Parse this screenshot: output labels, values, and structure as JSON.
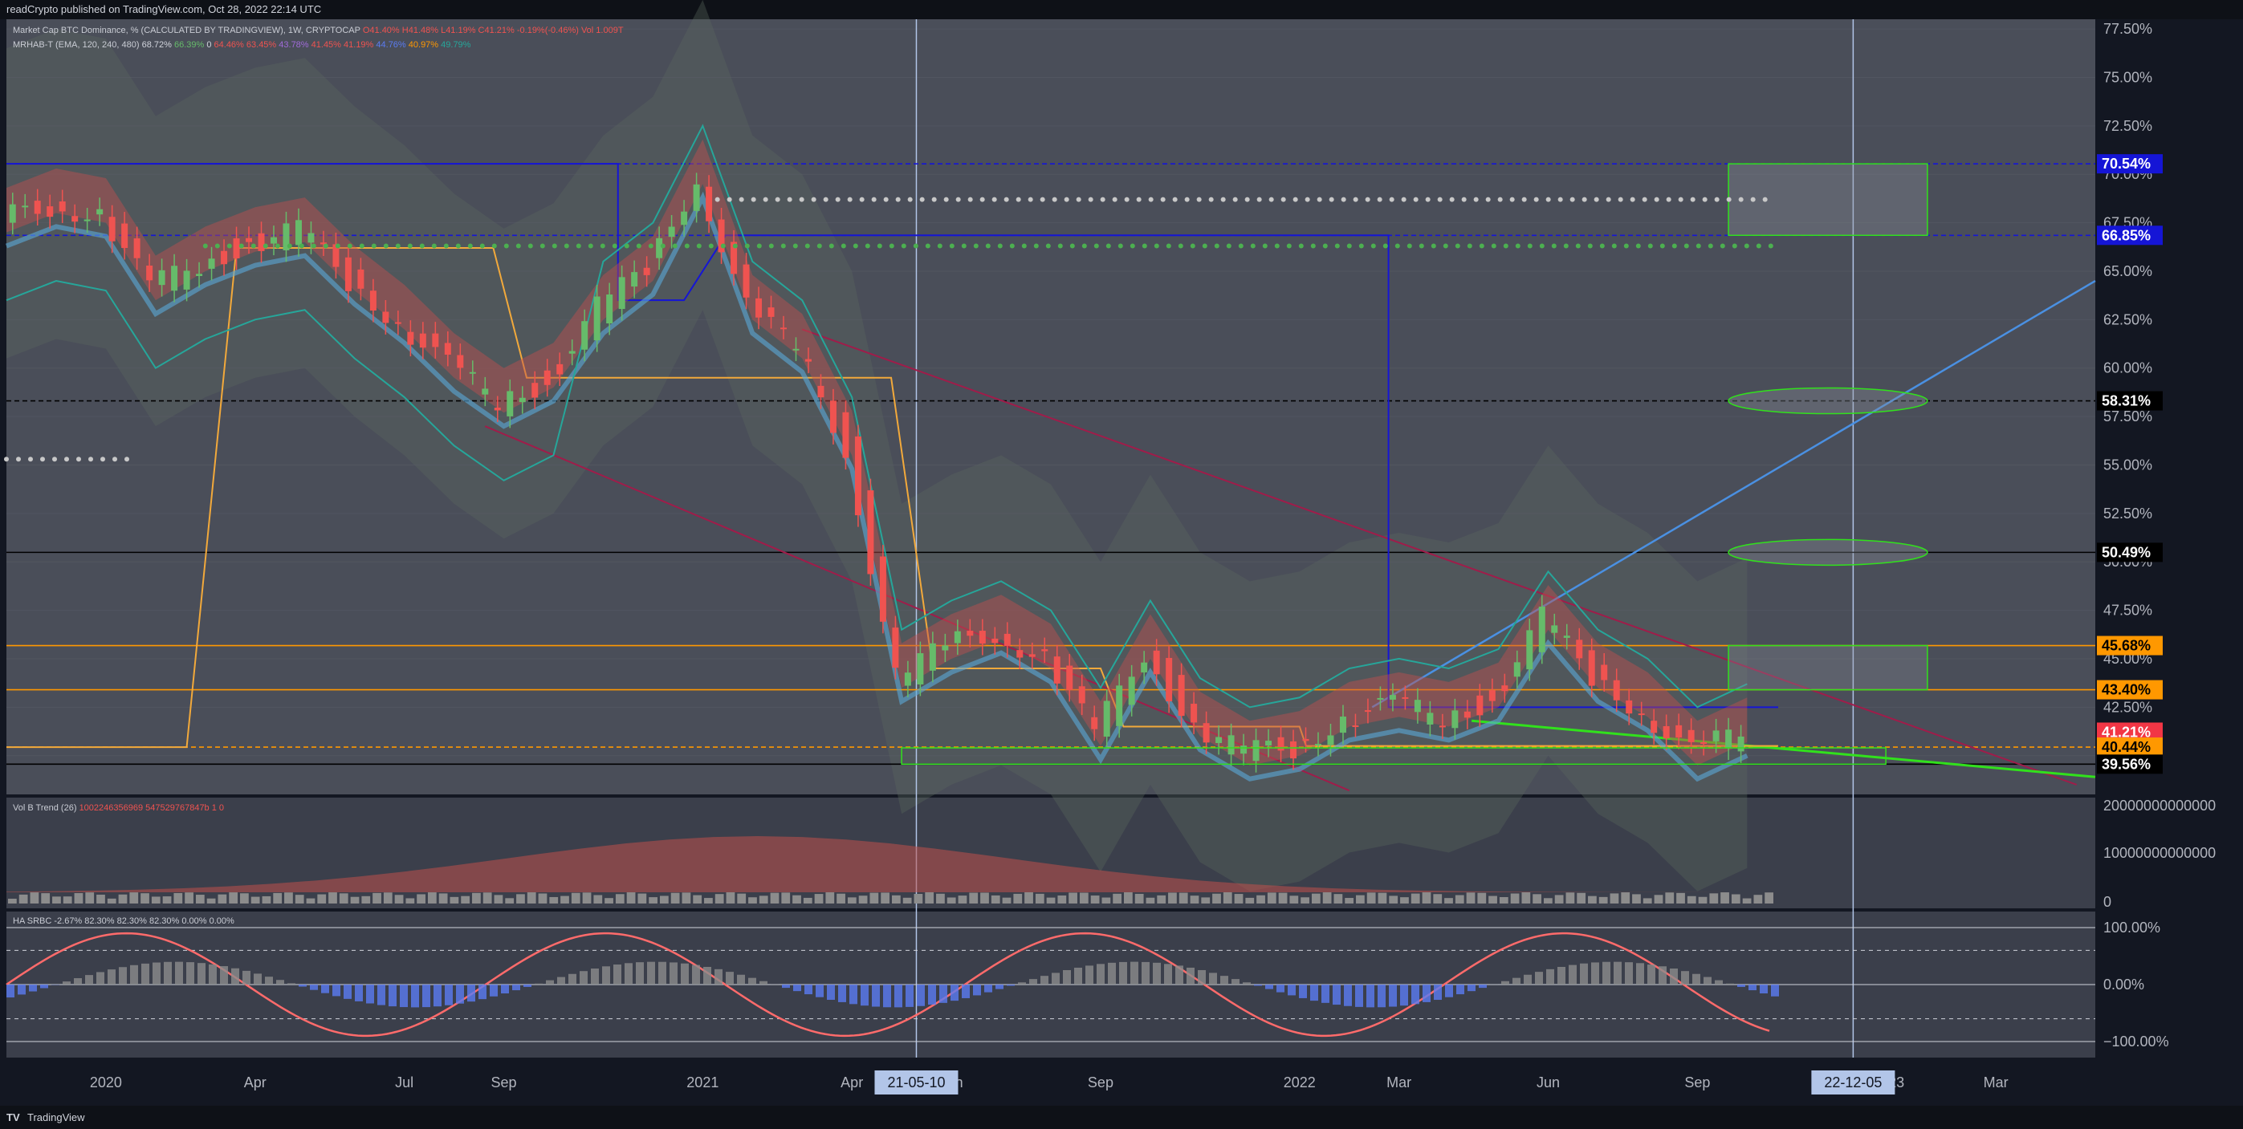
{
  "header": {
    "published_text": "readCrypto published on TradingView.com, Oct 28, 2022 22:14 UTC"
  },
  "legend": {
    "main_title": "Market Cap BTC Dominance, %  (CALCULATED BY TRADINGVIEW), 1W, CRYPTOCAP",
    "ohlc": "O41.40%  H41.48%  L41.19%  C41.21%  -0.19%(-0.46%)  Vol 1.009T",
    "mrhab_name": "MRHAB-T (EMA, 120, 240, 480)",
    "mrhab_values": [
      "68.72%",
      "66.39%",
      "0",
      "64.46%",
      "63.45%",
      "43.78%",
      "41.45%",
      "41.19%",
      "44.76%",
      "40.97%",
      "49.79%"
    ]
  },
  "vol_pane": {
    "label": "Vol B Trend (26)",
    "values": "1002246356969  547529767847b  1  0"
  },
  "osc_pane": {
    "label": "HA SRBC",
    "values": "-2.67%  82.30%  82.30%  82.30%  0.00%  0.00%"
  },
  "footer": {
    "logo_text": "TradingView",
    "logo_mark": "TV"
  },
  "price_axis": {
    "ticks": [
      "77.50%",
      "75.00%",
      "72.50%",
      "70.00%",
      "67.50%",
      "65.00%",
      "62.50%",
      "60.00%",
      "57.50%",
      "55.00%",
      "52.50%",
      "50.00%",
      "47.50%",
      "45.00%",
      "42.50%",
      "40.00%"
    ],
    "tick_values": [
      77.5,
      75.0,
      72.5,
      70.0,
      67.5,
      65.0,
      62.5,
      60.0,
      57.5,
      55.0,
      52.5,
      50.0,
      47.5,
      45.0,
      42.5,
      40.0
    ],
    "labels": [
      {
        "text": "70.54%",
        "value": 70.54,
        "bg": "#1515d6",
        "fg": "#ffffff"
      },
      {
        "text": "66.85%",
        "value": 66.85,
        "bg": "#1515d6",
        "fg": "#ffffff"
      },
      {
        "text": "58.31%",
        "value": 58.31,
        "bg": "#000000",
        "fg": "#ffffff"
      },
      {
        "text": "50.49%",
        "value": 50.49,
        "bg": "#000000",
        "fg": "#ffffff"
      },
      {
        "text": "45.68%",
        "value": 45.68,
        "bg": "#ff9800",
        "fg": "#000000"
      },
      {
        "text": "43.40%",
        "value": 43.4,
        "bg": "#ff9800",
        "fg": "#000000"
      },
      {
        "text": "41.21%",
        "value": 41.21,
        "bg": "#f23645",
        "fg": "#ffffff",
        "sub": "2d 2h"
      },
      {
        "text": "40.44%",
        "value": 40.44,
        "bg": "#ff9800",
        "fg": "#000000"
      },
      {
        "text": "39.56%",
        "value": 39.56,
        "bg": "#000000",
        "fg": "#ffffff"
      }
    ]
  },
  "vol_axis": {
    "ticks": [
      "20000000000000",
      "10000000000000",
      "0"
    ]
  },
  "osc_axis": {
    "ticks": [
      "100.00%",
      "0.00%",
      "−100.00%"
    ]
  },
  "time_axis": {
    "ticks": [
      "2020",
      "Apr",
      "Jul",
      "Sep",
      "2021",
      "Apr",
      "Jun",
      "Sep",
      "2022",
      "Mar",
      "Jun",
      "Sep",
      "23",
      "Mar"
    ],
    "highlight_left": "21-05-10",
    "highlight_right": "22-12-05"
  },
  "colors": {
    "background": "#131722",
    "pane": "#2a2e39",
    "up_candle": "#66bb6a",
    "down_candle": "#ef5350",
    "blue_line": "#1515d6",
    "orange_line": "#ff9800",
    "red_channel": "#a01c4a",
    "trend_blue": "#4a90e2",
    "trend_green": "#31e11c"
  },
  "chart_data": {
    "type": "candlestick",
    "title": "Market Cap BTC Dominance, %",
    "timeframe": "1W",
    "ylim": [
      38.0,
      78.0
    ],
    "x_range": [
      "2019-11",
      "2023-05"
    ],
    "log_scale": false,
    "grid": true,
    "dominance_path": [
      {
        "date": "2019-11",
        "value": 67.5
      },
      {
        "date": "2019-12",
        "value": 68.5
      },
      {
        "date": "2020-01",
        "value": 68.0
      },
      {
        "date": "2020-02",
        "value": 64.0
      },
      {
        "date": "2020-03",
        "value": 65.5
      },
      {
        "date": "2020-04",
        "value": 66.5
      },
      {
        "date": "2020-05",
        "value": 67.0
      },
      {
        "date": "2020-06",
        "value": 64.5
      },
      {
        "date": "2020-07",
        "value": 62.5
      },
      {
        "date": "2020-08",
        "value": 60.0
      },
      {
        "date": "2020-09",
        "value": 58.2
      },
      {
        "date": "2020-10",
        "value": 59.5
      },
      {
        "date": "2020-11",
        "value": 63.0
      },
      {
        "date": "2020-12",
        "value": 65.0
      },
      {
        "date": "2021-01",
        "value": 70.0
      },
      {
        "date": "2021-02",
        "value": 63.0
      },
      {
        "date": "2021-03",
        "value": 61.0
      },
      {
        "date": "2021-04",
        "value": 56.0
      },
      {
        "date": "2021-05",
        "value": 44.0
      },
      {
        "date": "2021-06",
        "value": 45.5
      },
      {
        "date": "2021-07",
        "value": 46.5
      },
      {
        "date": "2021-08",
        "value": 45.0
      },
      {
        "date": "2021-09",
        "value": 41.0
      },
      {
        "date": "2021-10",
        "value": 45.5
      },
      {
        "date": "2021-11",
        "value": 41.5
      },
      {
        "date": "2021-12",
        "value": 40.0
      },
      {
        "date": "2022-01",
        "value": 40.5
      },
      {
        "date": "2022-02",
        "value": 42.0
      },
      {
        "date": "2022-03",
        "value": 42.5
      },
      {
        "date": "2022-04",
        "value": 42.0
      },
      {
        "date": "2022-05",
        "value": 43.0
      },
      {
        "date": "2022-06",
        "value": 47.0
      },
      {
        "date": "2022-07",
        "value": 44.0
      },
      {
        "date": "2022-08",
        "value": 42.5
      },
      {
        "date": "2022-09",
        "value": 40.0
      },
      {
        "date": "2022-10",
        "value": 41.2
      }
    ],
    "horizontal_levels": [
      {
        "value": 70.54,
        "color": "#1515d6",
        "style": "dashed"
      },
      {
        "value": 66.85,
        "color": "#1515d6",
        "style": "dashed"
      },
      {
        "value": 58.31,
        "color": "#000000",
        "style": "dashed"
      },
      {
        "value": 50.49,
        "color": "#000000",
        "style": "solid"
      },
      {
        "value": 45.68,
        "color": "#ff9800",
        "style": "solid"
      },
      {
        "value": 43.4,
        "color": "#ff9800",
        "style": "solid"
      },
      {
        "value": 40.44,
        "color": "#ff9800",
        "style": "dashed"
      },
      {
        "value": 39.56,
        "color": "#000000",
        "style": "solid"
      }
    ],
    "vertical_markers": [
      "2021-05-10",
      "2022-12-05"
    ]
  }
}
